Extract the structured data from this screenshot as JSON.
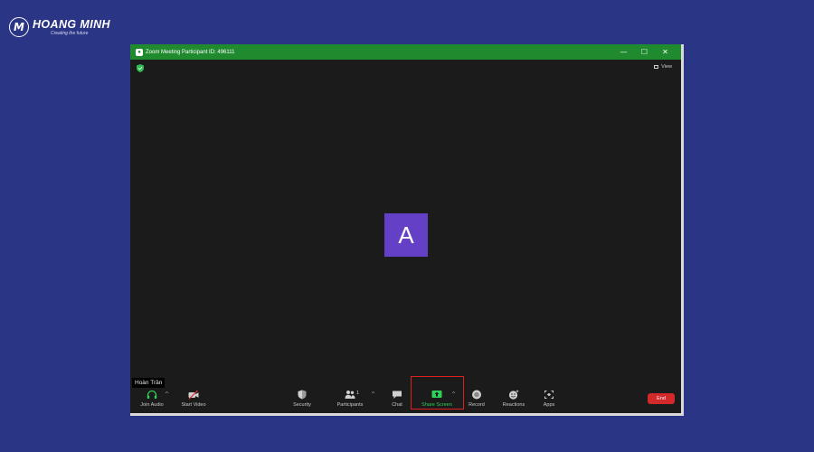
{
  "brand": {
    "name": "HOANG MINH",
    "tagline": "Creating the future",
    "mark": "M"
  },
  "window": {
    "title": "Zoom Meeting Participant ID: 496111",
    "minimize": "—",
    "maximize": "☐",
    "close": "✕"
  },
  "view_label": "View",
  "avatar_initial": "A",
  "participant_name": "Hoàn Trần",
  "toolbar": {
    "join_audio": "Join Audio",
    "start_video": "Start Video",
    "security": "Security",
    "participants": "Participants",
    "participants_count": "1",
    "chat": "Chat",
    "share_screen": "Share Screen",
    "record": "Record",
    "reactions": "Reactions",
    "apps": "Apps",
    "end": "End"
  },
  "colors": {
    "background": "#2b3585",
    "titlebar": "#1f8a2e",
    "avatar": "#6340c6",
    "share_green": "#2ed15a",
    "end_red": "#d2292a",
    "highlight_red": "#e02020"
  },
  "icons": {
    "app": "zoom-app-icon",
    "shield": "shield-icon",
    "view": "view-icon",
    "audio": "headphones-icon",
    "video": "video-off-icon",
    "security": "shield-icon",
    "participants": "people-icon",
    "chat": "chat-icon",
    "share": "share-screen-icon",
    "record": "record-icon",
    "reactions": "smiley-icon",
    "apps": "apps-icon"
  }
}
